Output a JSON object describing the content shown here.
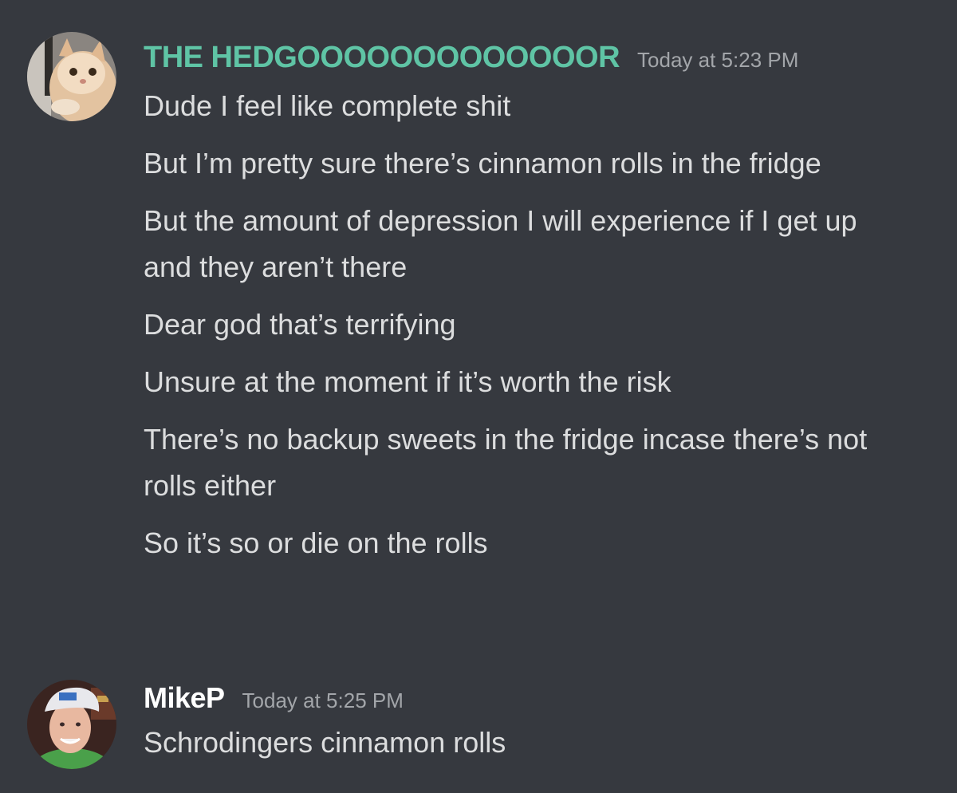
{
  "messages": [
    {
      "author": "THE HEDGOOOOOOOOOOOOOR",
      "author_color": "#5fc4a5",
      "avatar": "cat-avatar",
      "timestamp": "Today at 5:23 PM",
      "lines": [
        "Dude I feel like complete shit",
        "But I’m pretty sure there’s cinnamon rolls in the fridge",
        "But the amount of depression I will experience if I get up and they aren’t there",
        "Dear god that’s terrifying",
        "Unsure at the moment if it’s worth the risk",
        "There’s no backup sweets in the fridge incase there’s not rolls either",
        "So it’s so or die on the rolls"
      ]
    },
    {
      "author": "MikeP",
      "author_color": "#ffffff",
      "avatar": "person-avatar",
      "timestamp": "Today at 5:25 PM",
      "lines": [
        "Schrodingers cinnamon rolls"
      ]
    }
  ]
}
